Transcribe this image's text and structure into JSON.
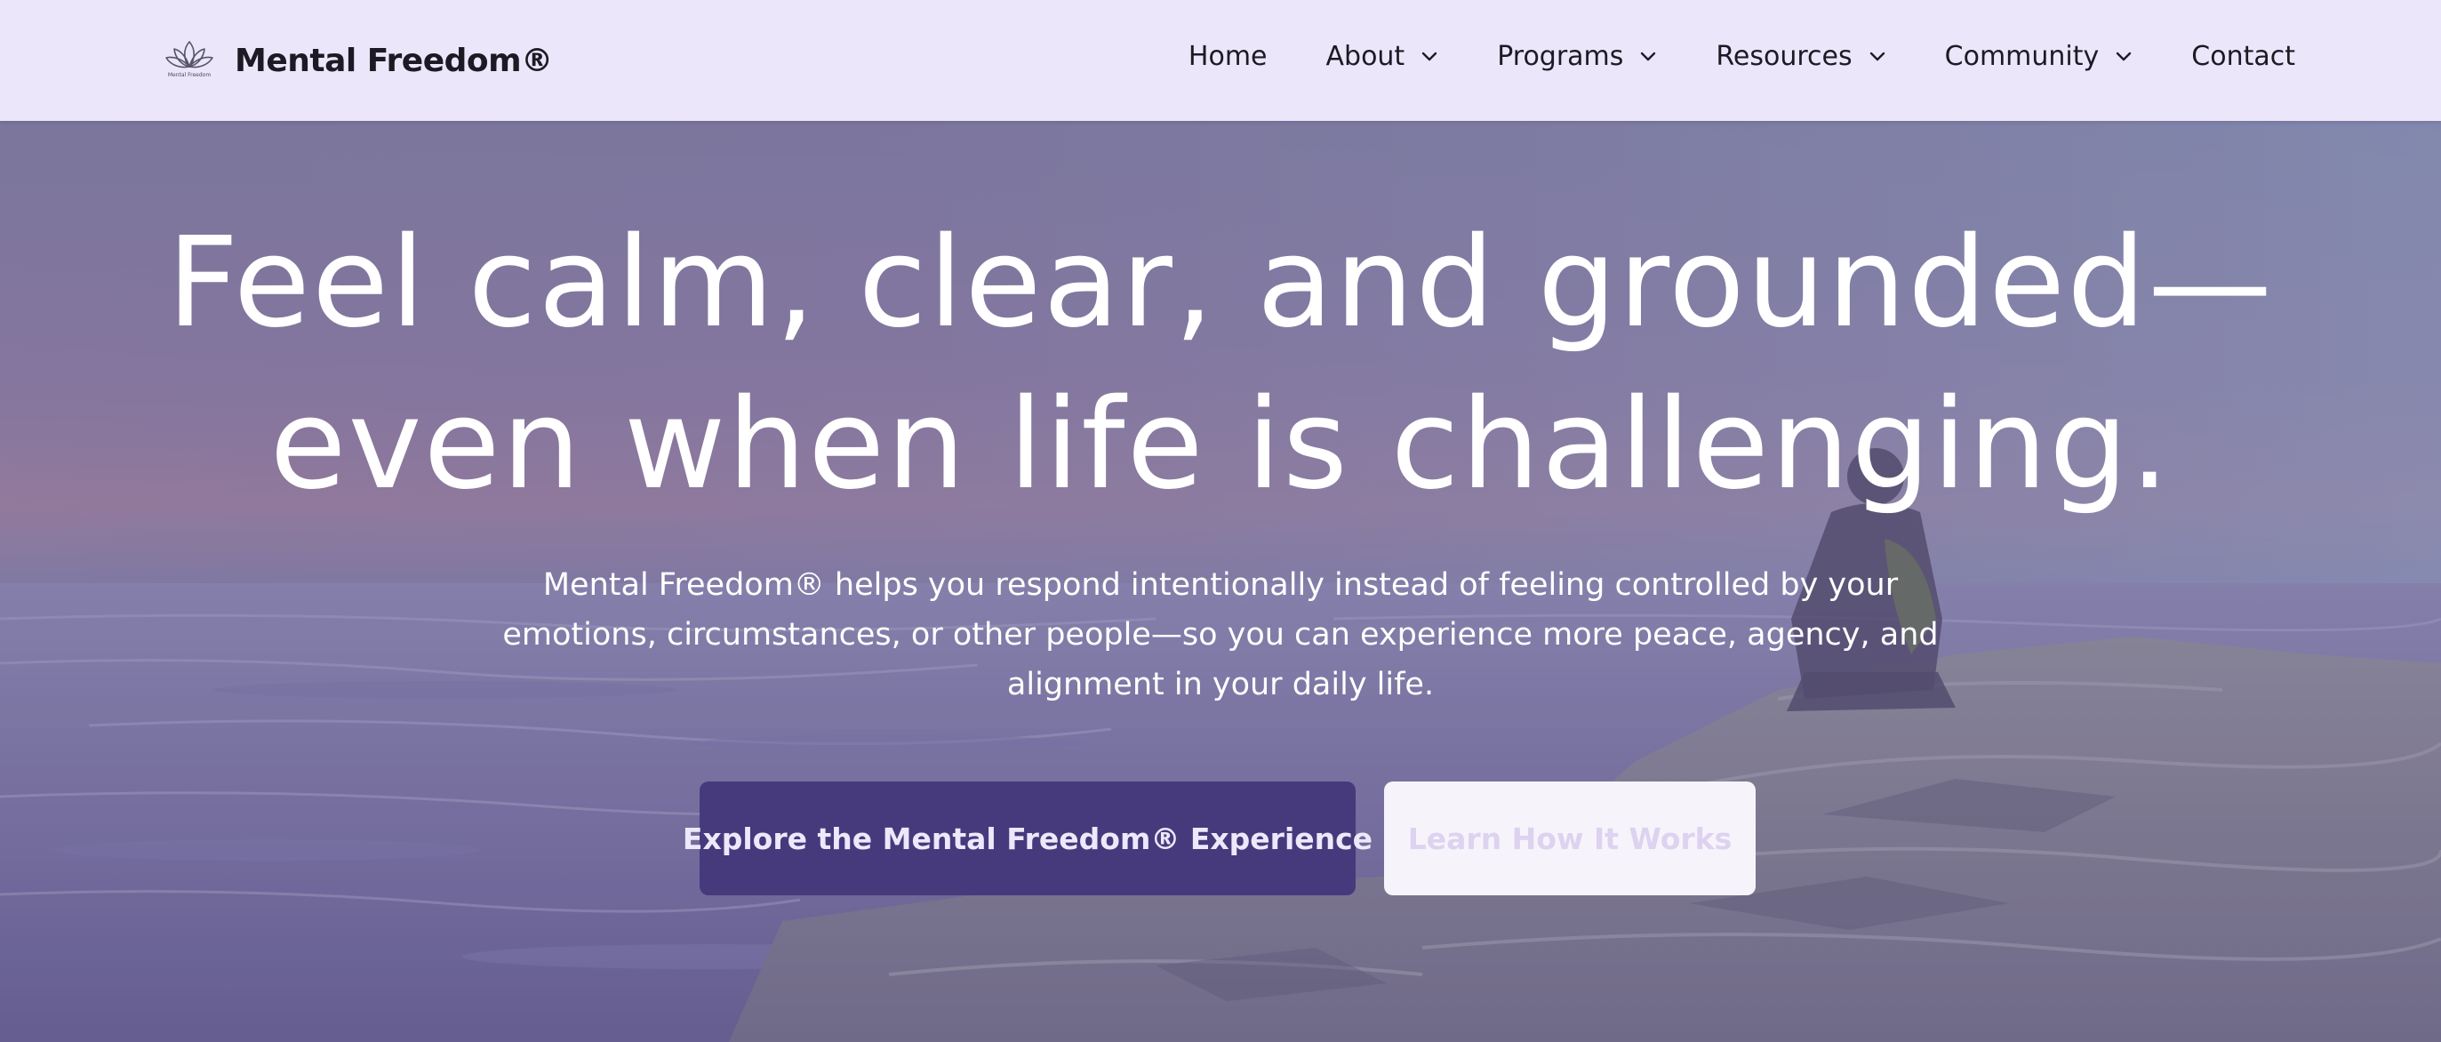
{
  "brand": {
    "name": "Mental Freedom®",
    "logo_caption": "Mental Freedom",
    "logo_icon": "lotus-icon"
  },
  "nav": {
    "items": [
      {
        "label": "Home",
        "has_dropdown": false
      },
      {
        "label": "About",
        "has_dropdown": true
      },
      {
        "label": "Programs",
        "has_dropdown": true
      },
      {
        "label": "Resources",
        "has_dropdown": true
      },
      {
        "label": "Community",
        "has_dropdown": true
      },
      {
        "label": "Contact",
        "has_dropdown": false
      }
    ]
  },
  "hero": {
    "title_line1": "Feel calm, clear, and grounded—",
    "title_line2": "even when life is challenging.",
    "subtitle": "Mental Freedom® helps you respond intentionally instead of feeling controlled by your emotions, circumstances, or other people—so you can experience more peace, agency, and alignment in your daily life.",
    "primary_cta": "Explore the Mental Freedom® Experience",
    "secondary_cta": "Learn How It Works"
  },
  "colors": {
    "header_bg": "#ece6fa",
    "primary_button": "#463a7c",
    "secondary_button": "#f6f4fa",
    "hero_overlay": "#6e6496"
  }
}
